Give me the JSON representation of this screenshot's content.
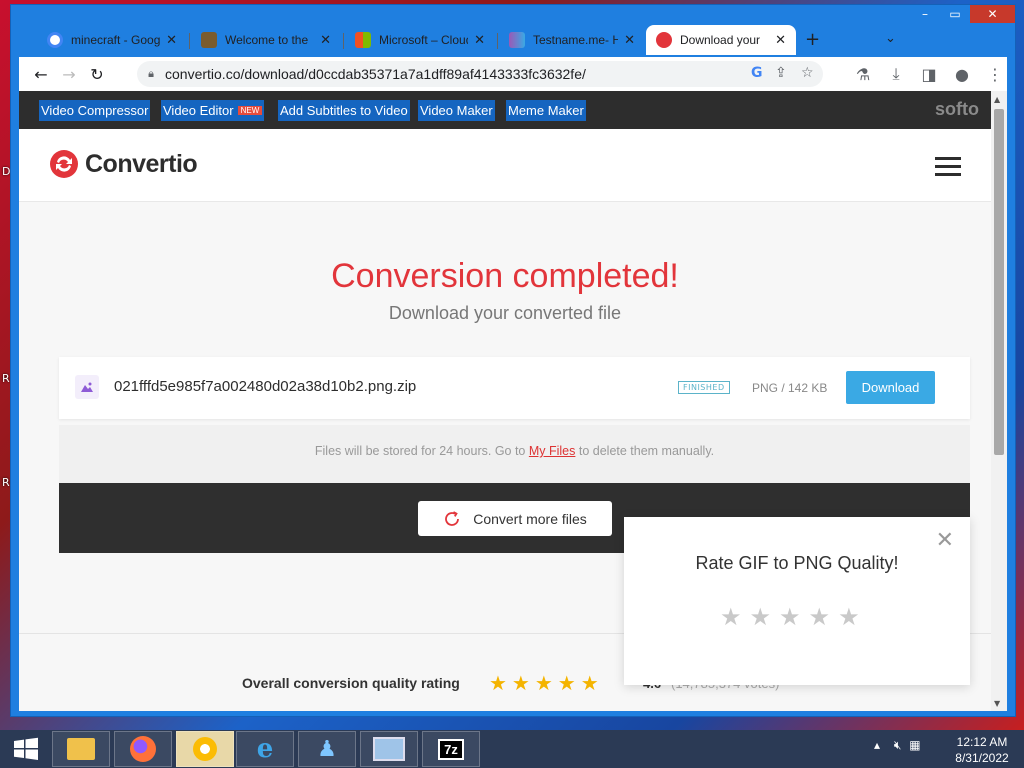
{
  "desktop": {
    "fragments": [
      "D",
      "R",
      "R"
    ]
  },
  "browser": {
    "tabs": [
      {
        "title": "minecraft - Google",
        "close": "✕",
        "color": "#4285f4"
      },
      {
        "title": "Welcome to the",
        "close": "✕",
        "color": "#7a5c2e"
      },
      {
        "title": "Microsoft – Cloud",
        "close": "✕",
        "color": "#f25022"
      },
      {
        "title": "Testname.me- H",
        "close": "✕",
        "color": "#9b59b6"
      },
      {
        "title": "Download your",
        "close": "✕",
        "color": "#e2353b",
        "active": true
      }
    ],
    "new_tab": "+",
    "tab_search": "⌄",
    "url": "convertio.co/download/d0ccdab35371a7a1dff89af4143333fc3632fe/",
    "window_controls": {
      "minimize": "–",
      "maximize": "▭",
      "close": "✕"
    }
  },
  "site": {
    "nav": [
      {
        "label": "Video Compressor"
      },
      {
        "label": "Video Editor",
        "badge": "NEW"
      },
      {
        "label": "Add Subtitles to Video"
      },
      {
        "label": "Video Maker"
      },
      {
        "label": "Meme Maker"
      }
    ],
    "brand_right": "softo",
    "logo_text": "Convertio",
    "headline": "Conversion completed!",
    "subheadline": "Download your converted file",
    "file": {
      "name": "021fffd5e985f7a002480d02a38d10b2.png.zip",
      "status": "FINISHED",
      "meta": "PNG / 142 KB",
      "download_label": "Download"
    },
    "storage_note": {
      "prefix": "Files will be stored for 24 hours. Go to ",
      "link": "My Files",
      "suffix": " to delete them manually."
    },
    "convert_more": "Convert more files",
    "overall": {
      "label": "Overall conversion quality rating",
      "stars": "★★★★★",
      "score": "4.6",
      "votes": "(14,785,374 votes)"
    },
    "rate_popup": {
      "title": "Rate GIF to PNG Quality!",
      "close": "✕",
      "stars": [
        "★",
        "★",
        "★",
        "★",
        "★"
      ]
    }
  },
  "taskbar": {
    "clock_time": "12:12 AM",
    "clock_date": "8/31/2022",
    "apps": [
      "file-explorer",
      "firefox",
      "chrome",
      "internet-explorer",
      "people",
      "control-panel",
      "7zip"
    ],
    "sevenzip_label": "7z"
  },
  "colors": {
    "accent_red": "#e2353b",
    "download_blue": "#3aa9e4",
    "nav_dark": "#2d2d2d",
    "star_gold": "#f4b400"
  }
}
